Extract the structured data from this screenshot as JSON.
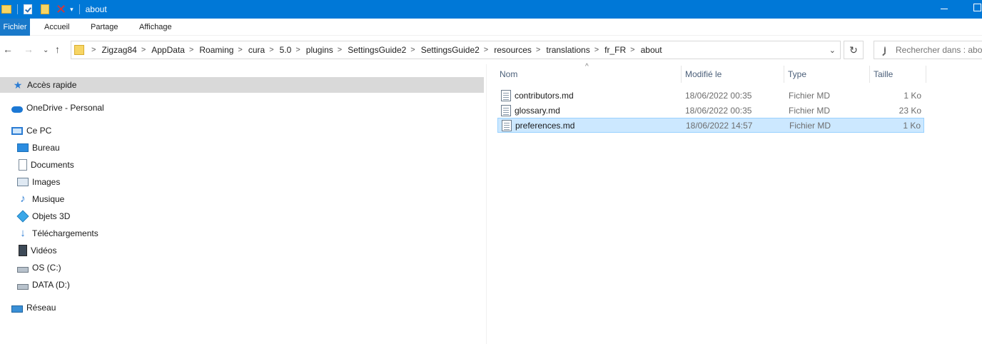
{
  "window": {
    "title": "about"
  },
  "ribbon": {
    "tabs": [
      "Fichier",
      "Accueil",
      "Partage",
      "Affichage"
    ]
  },
  "address": {
    "crumbs": [
      "Zigzag84",
      "AppData",
      "Roaming",
      "cura",
      "5.0",
      "plugins",
      "SettingsGuide2",
      "SettingsGuide2",
      "resources",
      "translations",
      "fr_FR",
      "about"
    ]
  },
  "search": {
    "placeholder": "Rechercher dans : about"
  },
  "navpane": {
    "quick_access": "Accès rapide",
    "onedrive": "OneDrive - Personal",
    "this_pc": "Ce PC",
    "desktop": "Bureau",
    "documents": "Documents",
    "images": "Images",
    "music": "Musique",
    "objects3d": "Objets 3D",
    "downloads": "Téléchargements",
    "videos": "Vidéos",
    "drive_c": "OS (C:)",
    "drive_d": "DATA (D:)",
    "network": "Réseau"
  },
  "columns": {
    "name": "Nom",
    "modified": "Modifié le",
    "type": "Type",
    "size": "Taille"
  },
  "files": [
    {
      "name": "contributors.md",
      "modified": "18/06/2022 00:35",
      "type": "Fichier MD",
      "size": "1 Ko",
      "selected": false
    },
    {
      "name": "glossary.md",
      "modified": "18/06/2022 00:35",
      "type": "Fichier MD",
      "size": "23 Ko",
      "selected": false
    },
    {
      "name": "preferences.md",
      "modified": "18/06/2022 14:57",
      "type": "Fichier MD",
      "size": "1 Ko",
      "selected": true
    }
  ],
  "colors": {
    "titlebar": "#0078d7",
    "file_tab": "#1979ca",
    "selection": "#cce8ff",
    "nav_selected": "#d9d9d9"
  }
}
